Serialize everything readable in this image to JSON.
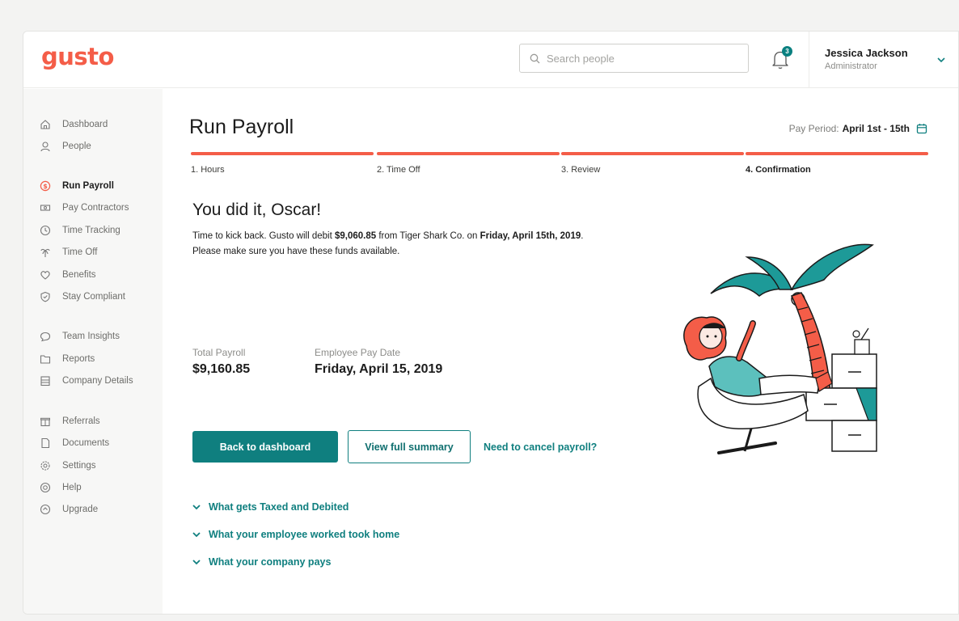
{
  "header": {
    "logo": "gusto",
    "search_placeholder": "Search people",
    "notifications_count": "3",
    "user_name": "Jessica Jackson",
    "user_role": "Administrator"
  },
  "sidebar": {
    "items": [
      {
        "label": "Dashboard",
        "icon": "home-icon"
      },
      {
        "label": "People",
        "icon": "person-icon"
      },
      {
        "label": "Run Payroll",
        "icon": "dollar-icon",
        "active": true
      },
      {
        "label": "Pay Contractors",
        "icon": "cash-icon"
      },
      {
        "label": "Time Tracking",
        "icon": "clock-icon"
      },
      {
        "label": "Time Off",
        "icon": "palm-icon"
      },
      {
        "label": "Benefits",
        "icon": "heart-icon"
      },
      {
        "label": "Stay Compliant",
        "icon": "shield-icon"
      },
      {
        "label": "Team Insights",
        "icon": "chat-icon"
      },
      {
        "label": "Reports",
        "icon": "folder-icon"
      },
      {
        "label": "Company Details",
        "icon": "building-icon"
      },
      {
        "label": "Referrals",
        "icon": "gift-icon"
      },
      {
        "label": "Documents",
        "icon": "document-icon"
      },
      {
        "label": "Settings",
        "icon": "gear-icon"
      },
      {
        "label": "Help",
        "icon": "help-icon"
      },
      {
        "label": "Upgrade",
        "icon": "upgrade-icon"
      }
    ]
  },
  "main": {
    "title": "Run Payroll",
    "pay_period_label": "Pay Period:",
    "pay_period_value": "April 1st - 15th",
    "steps": [
      "1. Hours",
      "2. Time Off",
      "3. Review",
      "4. Confirmation"
    ],
    "current_step": "4. Confirmation",
    "headline": "You did it, Oscar!",
    "message": {
      "p1": "Time to kick back. Gusto will debit ",
      "amount": "$9,060.85",
      "p2": " from Tiger Shark Co. on ",
      "date": "Friday, April 15th, 2019",
      "p3": ".",
      "line2": "Please make sure you have these funds available."
    },
    "total_payroll_label": "Total Payroll",
    "total_payroll_value": "$9,160.85",
    "pay_date_label": "Employee Pay Date",
    "pay_date_value": "Friday, April 15, 2019",
    "back_button": "Back to dashboard",
    "summary_button": "View full summary",
    "cancel_link": "Need to cancel payroll?",
    "accordions": [
      "What gets Taxed and Debited",
      "What your employee worked took home",
      "What your company pays"
    ]
  },
  "colors": {
    "brand": "#f45d48",
    "accent": "#0f7f7f"
  }
}
